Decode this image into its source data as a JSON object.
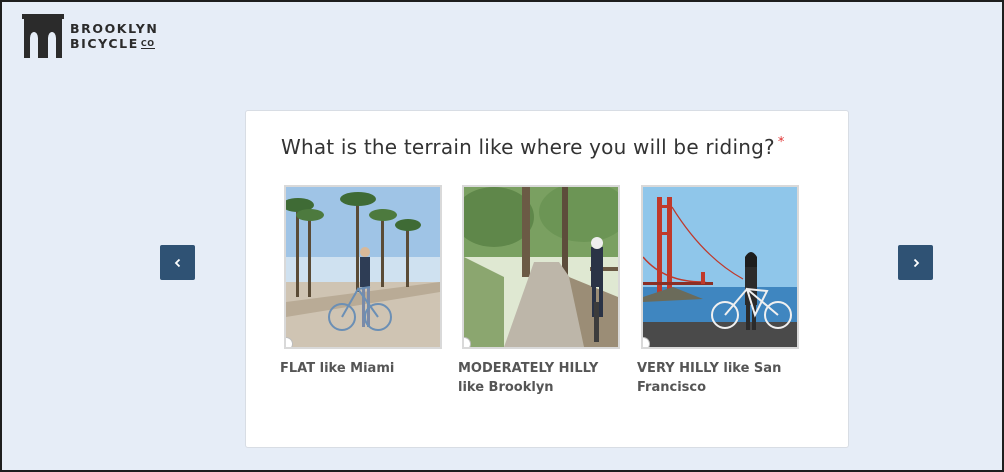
{
  "brand": {
    "line1": "BROOKLYN",
    "line2": "BICYCLE",
    "suffix": "CO"
  },
  "question": {
    "text": "What is the terrain like where you will be riding?",
    "required_mark": "*"
  },
  "options": [
    {
      "label": "FLAT like Miami",
      "image": "flat-terrain-photo",
      "selected": false
    },
    {
      "label": "MODERATELY HILLY like Brooklyn",
      "image": "hilly-path-photo",
      "selected": false
    },
    {
      "label": "VERY HILLY like San Francisco",
      "image": "golden-gate-photo",
      "selected": false
    }
  ],
  "nav": {
    "prev_icon": "chevron-left-icon",
    "next_icon": "chevron-right-icon",
    "button_color": "#2f5274"
  },
  "colors": {
    "background": "#e6edf7",
    "required": "#e03131"
  }
}
